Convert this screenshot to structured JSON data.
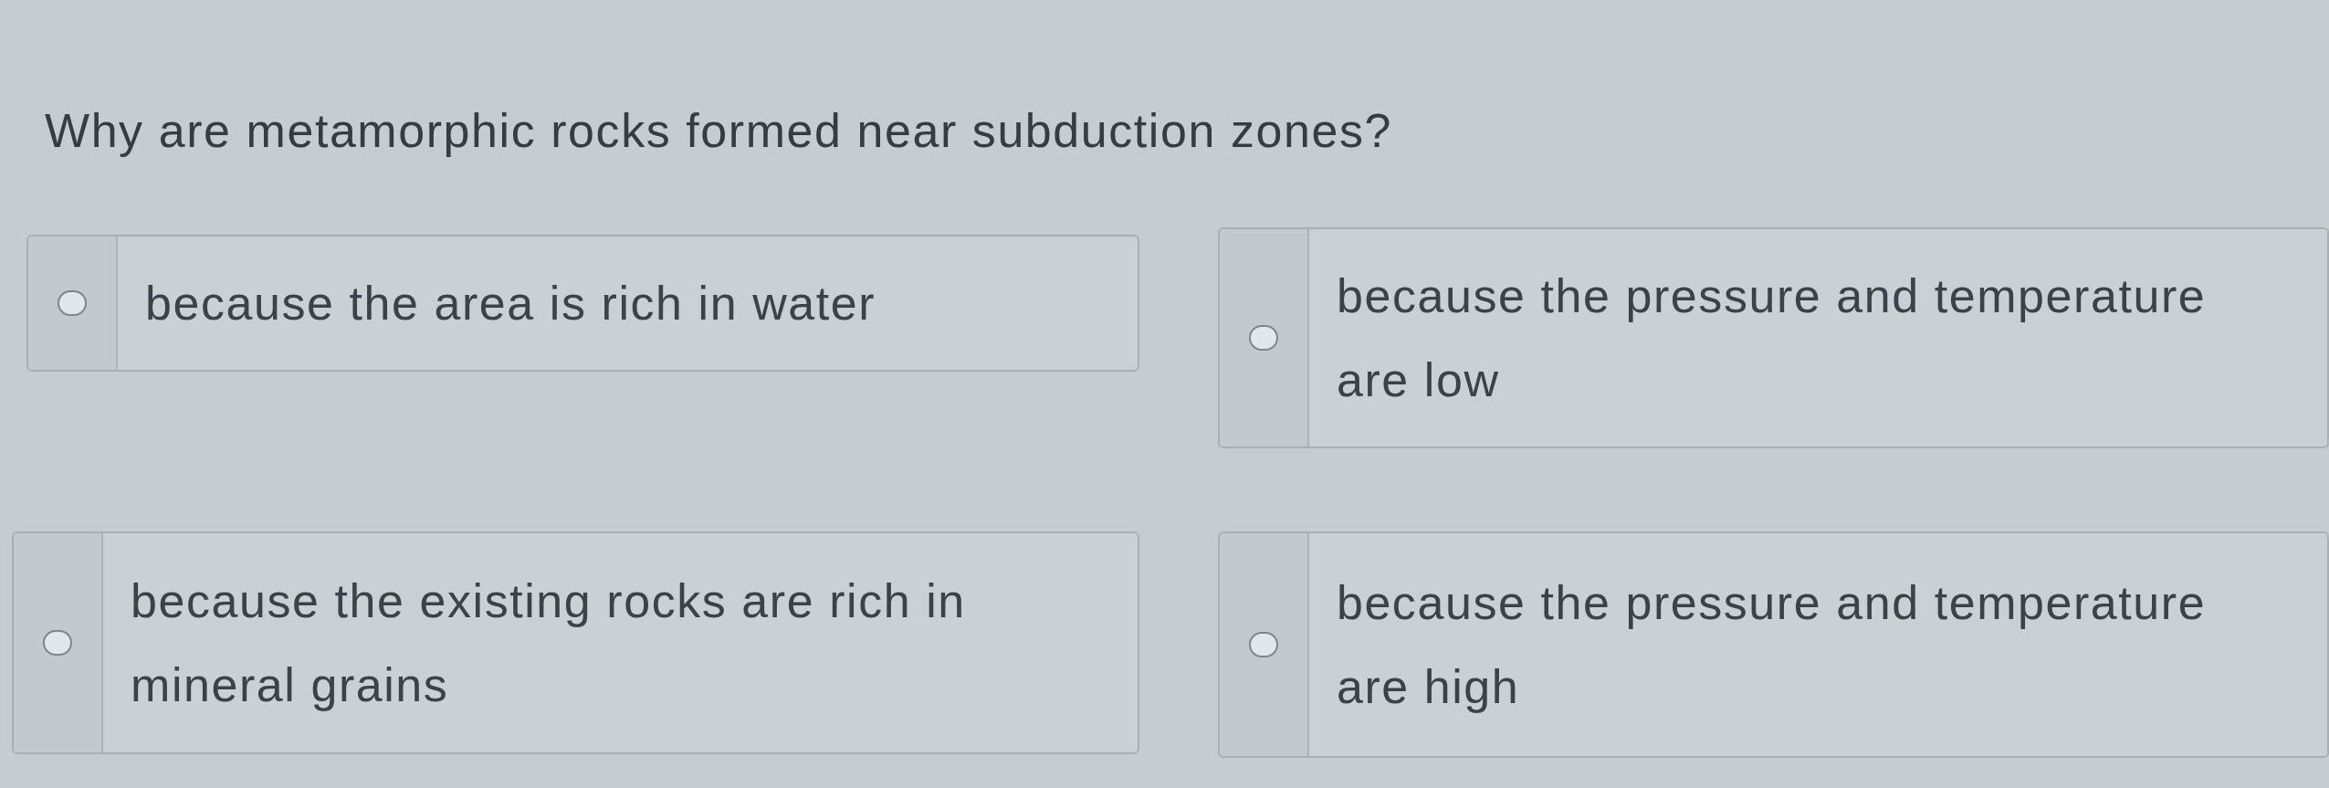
{
  "question": {
    "text": "Why are metamorphic rocks formed near subduction zones?"
  },
  "options": [
    {
      "text": "because the area is rich in water",
      "selected": false
    },
    {
      "text": "because the pressure and temperature are low",
      "selected": false
    },
    {
      "text": "because the existing rocks are rich in mineral grains",
      "selected": false
    },
    {
      "text": "because the pressure and temperature are high",
      "selected": false
    }
  ]
}
